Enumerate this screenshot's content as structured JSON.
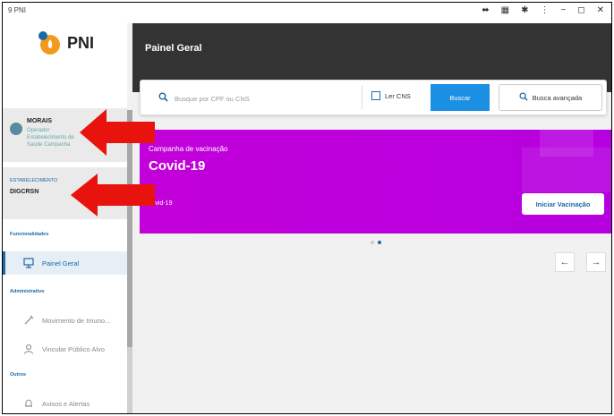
{
  "window": {
    "title": "9 PNI",
    "controls": [
      "⬌",
      "▦",
      "✱",
      "⋮",
      "−",
      "◻",
      "✕"
    ]
  },
  "logo": {
    "text": "PNI"
  },
  "user": {
    "name": "MORAIS",
    "role_lines": [
      "Operador",
      "Estabelecimento de",
      "Saúde Campanha"
    ]
  },
  "estabelecimento": {
    "label": "ESTABELECIMENTO",
    "value": "DIGCRSN"
  },
  "sidebar": {
    "sections": [
      {
        "label": "Funcionalidades",
        "items": [
          {
            "label": "Painel Geral",
            "icon": "dashboard-icon",
            "active": true
          }
        ]
      },
      {
        "label": "Administrativo",
        "items": [
          {
            "label": "Movimento de Imuno...",
            "icon": "syringe-icon",
            "active": false
          },
          {
            "label": "Vincular Público Alvo",
            "icon": "person-icon",
            "active": false
          }
        ]
      },
      {
        "label": "Outros",
        "items": [
          {
            "label": "Avisos e Alertas",
            "icon": "bell-icon",
            "active": false
          }
        ]
      }
    ]
  },
  "header": {
    "title": "Painel Geral"
  },
  "search": {
    "placeholder": "Busque por CPF ou CNS",
    "ler_cns_label": "Ler CNS",
    "buscar_label": "Buscar",
    "avancada_label": "Busca avançada"
  },
  "campaign": {
    "subtitle": "Campanha de vacinação",
    "title": "Covid-19",
    "tag": "covid-19",
    "button_label": "Iniciar Vacinação",
    "color": "#c200d9"
  },
  "carousel": {
    "total": 2,
    "current": 2
  },
  "colors": {
    "accent": "#1a6aa8",
    "button_blue": "#1a8fe3",
    "annotation_arrow": "#e8130d",
    "header": "#333333"
  }
}
